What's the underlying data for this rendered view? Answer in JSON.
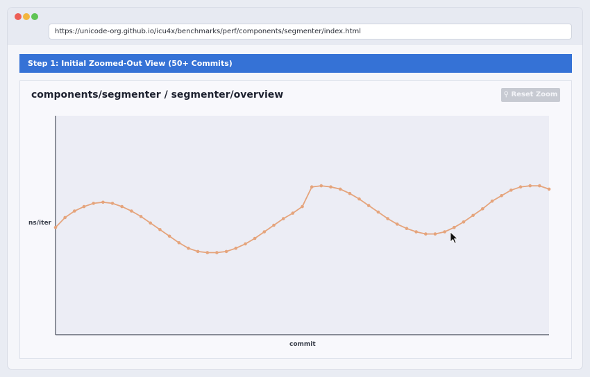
{
  "browser": {
    "url": "https://unicode-org.github.io/icu4x/benchmarks/perf/components/segmenter/index.html"
  },
  "banner": {
    "label": "Step 1: Initial Zoomed-Out View (50+ Commits)"
  },
  "chart_panel": {
    "title": "components/segmenter / segmenter/overview",
    "reset_zoom_label": "Reset Zoom",
    "reset_zoom_icon": "magnifier-icon"
  },
  "colors": {
    "banner": "#3572d6",
    "series": "#e5a47c",
    "plot_bg": "#ecedf5"
  },
  "chart_data": {
    "type": "line",
    "xlabel": "commit",
    "ylabel": "ns/iter",
    "grid": false,
    "legend": "none",
    "ylim": [
      0,
      100
    ],
    "series": [
      {
        "values": [
          49,
          53.5,
          56.5,
          58.5,
          60,
          60.5,
          60,
          58.5,
          56.5,
          54,
          51,
          48,
          45,
          42,
          39.5,
          38,
          37.5,
          37.5,
          38,
          39.5,
          41.5,
          44,
          47,
          50,
          53,
          55.5,
          58.5,
          67.5,
          68,
          67.5,
          66.5,
          64.5,
          62,
          59,
          56,
          53,
          50.5,
          48.5,
          47,
          46,
          46,
          47,
          49,
          51.5,
          54.5,
          57.5,
          61,
          63.5,
          66,
          67.5,
          68,
          68,
          66.5
        ]
      }
    ]
  }
}
